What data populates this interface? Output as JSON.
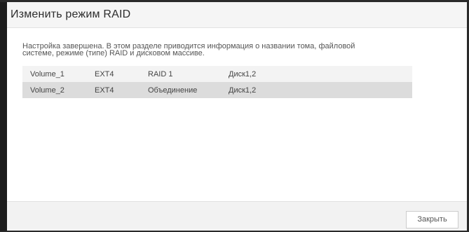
{
  "dialog": {
    "title": "Изменить режим RAID",
    "description_line1": "Настройка завершена. В этом разделе приводится информация о названии тома, файловой",
    "description_line2": "системе, режиме (типе) RAID и дисковом массиве.",
    "volumes": [
      {
        "name": "Volume_1",
        "filesystem": "EXT4",
        "raid_mode": "RAID 1",
        "disks": "Диск1,2"
      },
      {
        "name": "Volume_2",
        "filesystem": "EXT4",
        "raid_mode": "Объединение",
        "disks": "Диск1,2"
      }
    ],
    "close_label": "Закрыть"
  }
}
